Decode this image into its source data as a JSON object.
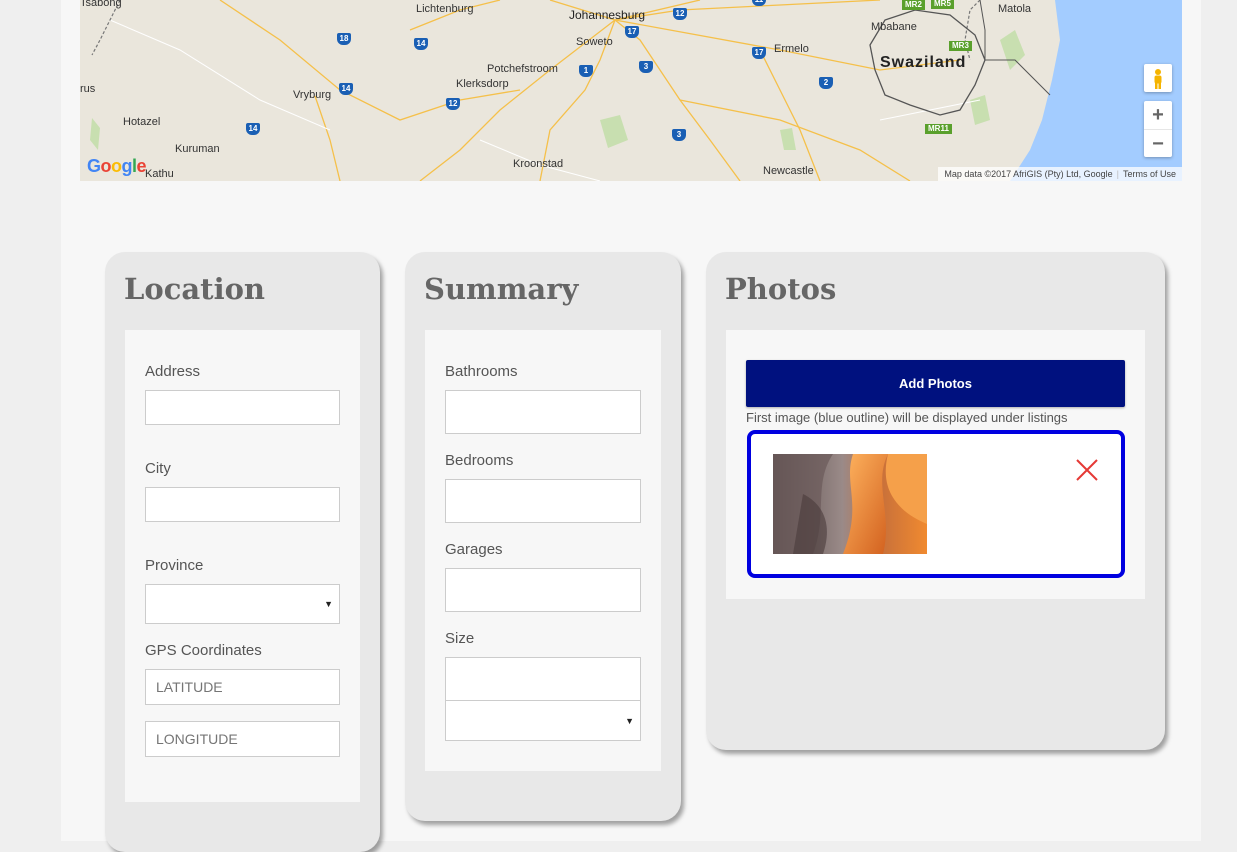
{
  "map": {
    "labels": {
      "johannesburg": "Johannesburg",
      "soweto": "Soweto",
      "lichtenburg": "Lichtenburg",
      "potchefstroom": "Potchefstroom",
      "klerksdorp": "Klerksdorp",
      "vryburg": "Vryburg",
      "hotazel": "Hotazel",
      "kuruman": "Kuruman",
      "kathu": "Kathu",
      "kroonstad": "Kroonstad",
      "newcastle": "Newcastle",
      "ermelo": "Ermelo",
      "mbabane": "Mbabane",
      "swaziland": "Swaziland",
      "matola": "Matola",
      "tsabong": "Tsabong",
      "rus": "rus"
    },
    "shields": [
      "18",
      "14",
      "14",
      "14",
      "12",
      "12",
      "17",
      "3",
      "1",
      "3",
      "17",
      "2",
      "12",
      "11"
    ],
    "mr_roads": [
      "MR2",
      "MR5",
      "MR3",
      "MR11"
    ],
    "google_logo": "Google",
    "attribution": "Map data ©2017 AfriGIS (Pty) Ltd, Google",
    "terms": "Terms of Use",
    "zoom_in": "+",
    "zoom_out": "−"
  },
  "location": {
    "title": "Location",
    "address_label": "Address",
    "address_value": "",
    "city_label": "City",
    "city_value": "",
    "province_label": "Province",
    "province_value": "",
    "gps_label": "GPS Coordinates",
    "latitude_placeholder": "LATITUDE",
    "longitude_placeholder": "LONGITUDE"
  },
  "summary": {
    "title": "Summary",
    "bathrooms_label": "Bathrooms",
    "bedrooms_label": "Bedrooms",
    "garages_label": "Garages",
    "size_label": "Size",
    "size_unit_value": ""
  },
  "photos": {
    "title": "Photos",
    "add_button": "Add Photos",
    "hint": "First image (blue outline) will be displayed under listings"
  },
  "colors": {
    "primary_button": "#00117f",
    "featured_outline": "#0000e0",
    "remove_icon": "#e53935"
  }
}
